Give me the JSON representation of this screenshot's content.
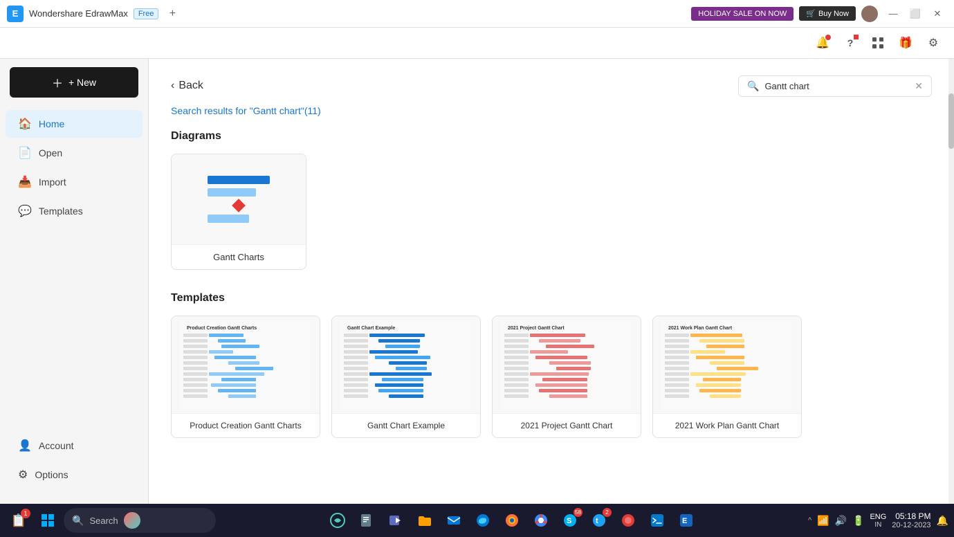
{
  "app": {
    "name": "Wondershare EdrawMax",
    "badge": "Free",
    "logo_letter": "E"
  },
  "titlebar": {
    "holiday_btn": "HOLIDAY SALE ON NOW",
    "buy_btn": "Buy Now",
    "add_tab_icon": "+",
    "minimize": "—",
    "maximize": "⬜",
    "close": "✕"
  },
  "header_icons": {
    "notification": "🔔",
    "help": "?",
    "apps": "⊞",
    "gift": "🎁",
    "settings": "⚙"
  },
  "sidebar": {
    "new_label": "+ New",
    "nav_items": [
      {
        "id": "home",
        "label": "Home",
        "icon": "🏠",
        "active": true
      },
      {
        "id": "open",
        "label": "Open",
        "icon": "📄"
      },
      {
        "id": "import",
        "label": "Import",
        "icon": "📥"
      },
      {
        "id": "templates",
        "label": "Templates",
        "icon": "💬"
      }
    ],
    "bottom_items": [
      {
        "id": "account",
        "label": "Account",
        "icon": "👤"
      },
      {
        "id": "options",
        "label": "Options",
        "icon": "⚙"
      }
    ]
  },
  "content": {
    "back_label": "Back",
    "search_value": "Gantt chart",
    "search_placeholder": "Gantt chart",
    "results_prefix": "Search results for ",
    "results_query": "\"Gantt chart\"",
    "results_count": "(11)",
    "diagrams_section": "Diagrams",
    "templates_section": "Templates",
    "diagram_cards": [
      {
        "label": "Gantt Charts"
      }
    ],
    "template_cards": [
      {
        "label": "Product Creation Gantt  Charts",
        "color_accent": "#64b5f6"
      },
      {
        "label": "Gantt Chart Example",
        "color_accent": "#1976d2"
      },
      {
        "label": "2021 Project Gantt Chart",
        "color_accent": "#e57373"
      },
      {
        "label": "2021 Work Plan Gantt Chart",
        "color_accent": "#ffb74d"
      }
    ]
  },
  "taskbar": {
    "search_placeholder": "Search",
    "notification_count": "1",
    "language": "ENG",
    "region": "IN",
    "time": "05:18 PM",
    "date": "20-12-2023",
    "apps": [
      "📋",
      "⊞",
      "🔵",
      "🗂",
      "📁",
      "📧",
      "🌐",
      "🦊",
      "🔵",
      "🟦",
      "🐦",
      "🔴",
      "💜",
      "🔷"
    ]
  }
}
